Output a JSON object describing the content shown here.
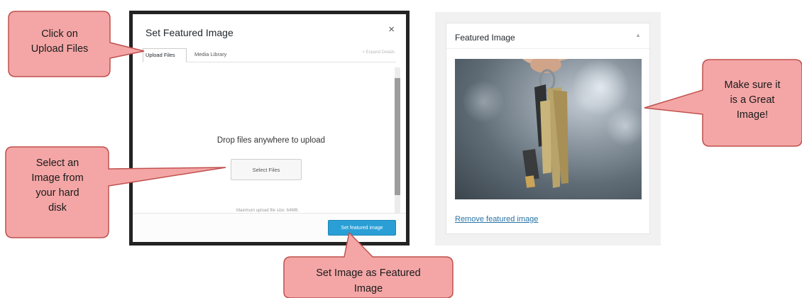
{
  "modal": {
    "title": "Set Featured Image",
    "close_glyph": "×",
    "tabs": [
      {
        "label": "Upload Files",
        "active": true
      },
      {
        "label": "Media Library",
        "active": false
      }
    ],
    "expand_details": "× Expand Details",
    "drop_text": "Drop files anywhere to upload",
    "select_files_label": "Select Files",
    "max_upload_text": "Maximum upload file size: 64MB.",
    "set_featured_label": "Set featured image"
  },
  "featured_panel": {
    "title": "Featured Image",
    "toggle_glyph": "▲",
    "image_icon": "keys-photo",
    "remove_link": "Remove featured image"
  },
  "callouts": [
    {
      "id": "upload",
      "text": "Click on\nUpload Files"
    },
    {
      "id": "select",
      "text": "Select an\nImage from\nyour hard\ndisk"
    },
    {
      "id": "set",
      "text": "Set Image as Featured\nImage"
    },
    {
      "id": "great",
      "text": "Make sure it\nis a Great\nImage!"
    }
  ],
  "colors": {
    "callout_fill": "#f4a6a6",
    "callout_stroke": "#c0504d",
    "primary_button": "#2a9fd6",
    "link": "#2774a6"
  }
}
